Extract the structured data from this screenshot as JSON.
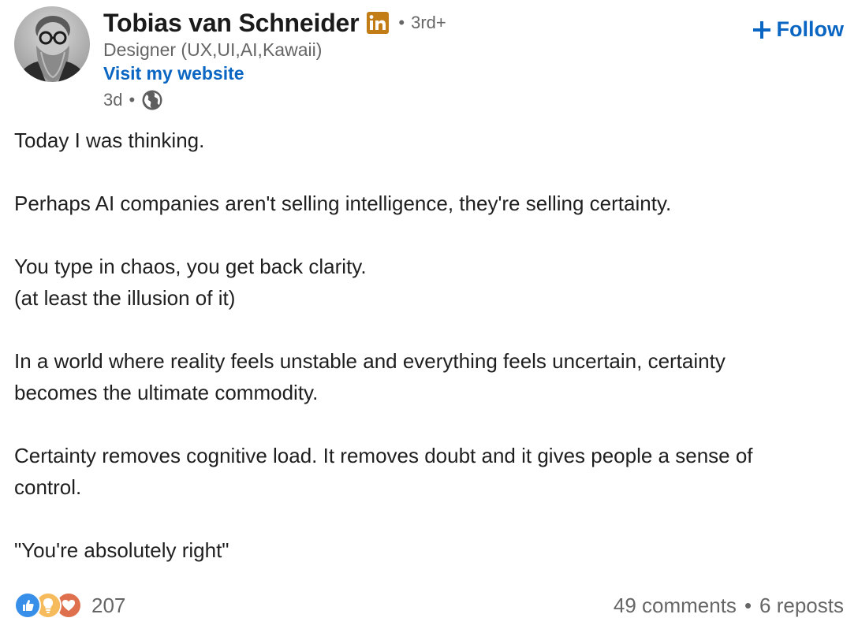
{
  "author": {
    "name": "Tobias van Schneider",
    "badge_icon": "linkedin-premium-icon",
    "degree_separator": "•",
    "degree": "3rd+",
    "headline": "Designer (UX,UI,AI,Kawaii)",
    "website_label": "Visit my website",
    "time": "3d",
    "time_separator": "•",
    "visibility_icon": "globe-icon"
  },
  "follow": {
    "label": "Follow",
    "icon": "plus-icon"
  },
  "post": {
    "paragraphs": [
      [
        "Today I was thinking."
      ],
      [
        "Perhaps AI companies aren't selling intelligence, they're selling certainty."
      ],
      [
        "You type in chaos, you get back clarity.",
        "(at least the illusion of it)"
      ],
      [
        "In a world where reality feels unstable and everything feels uncertain, certainty",
        "becomes the ultimate commodity."
      ],
      [
        "Certainty removes cognitive load. It removes doubt and it gives people a sense of",
        "control."
      ],
      [
        "\"You're absolutely right\""
      ]
    ]
  },
  "footer": {
    "reaction_icons": [
      "like-icon",
      "insightful-icon",
      "love-icon"
    ],
    "reaction_count": "207",
    "comments": "49 comments",
    "separator": "•",
    "reposts": "6 reposts"
  },
  "colors": {
    "link_blue": "#0a66c2",
    "secondary_text": "#666666",
    "badge_gold": "#c37d16"
  }
}
